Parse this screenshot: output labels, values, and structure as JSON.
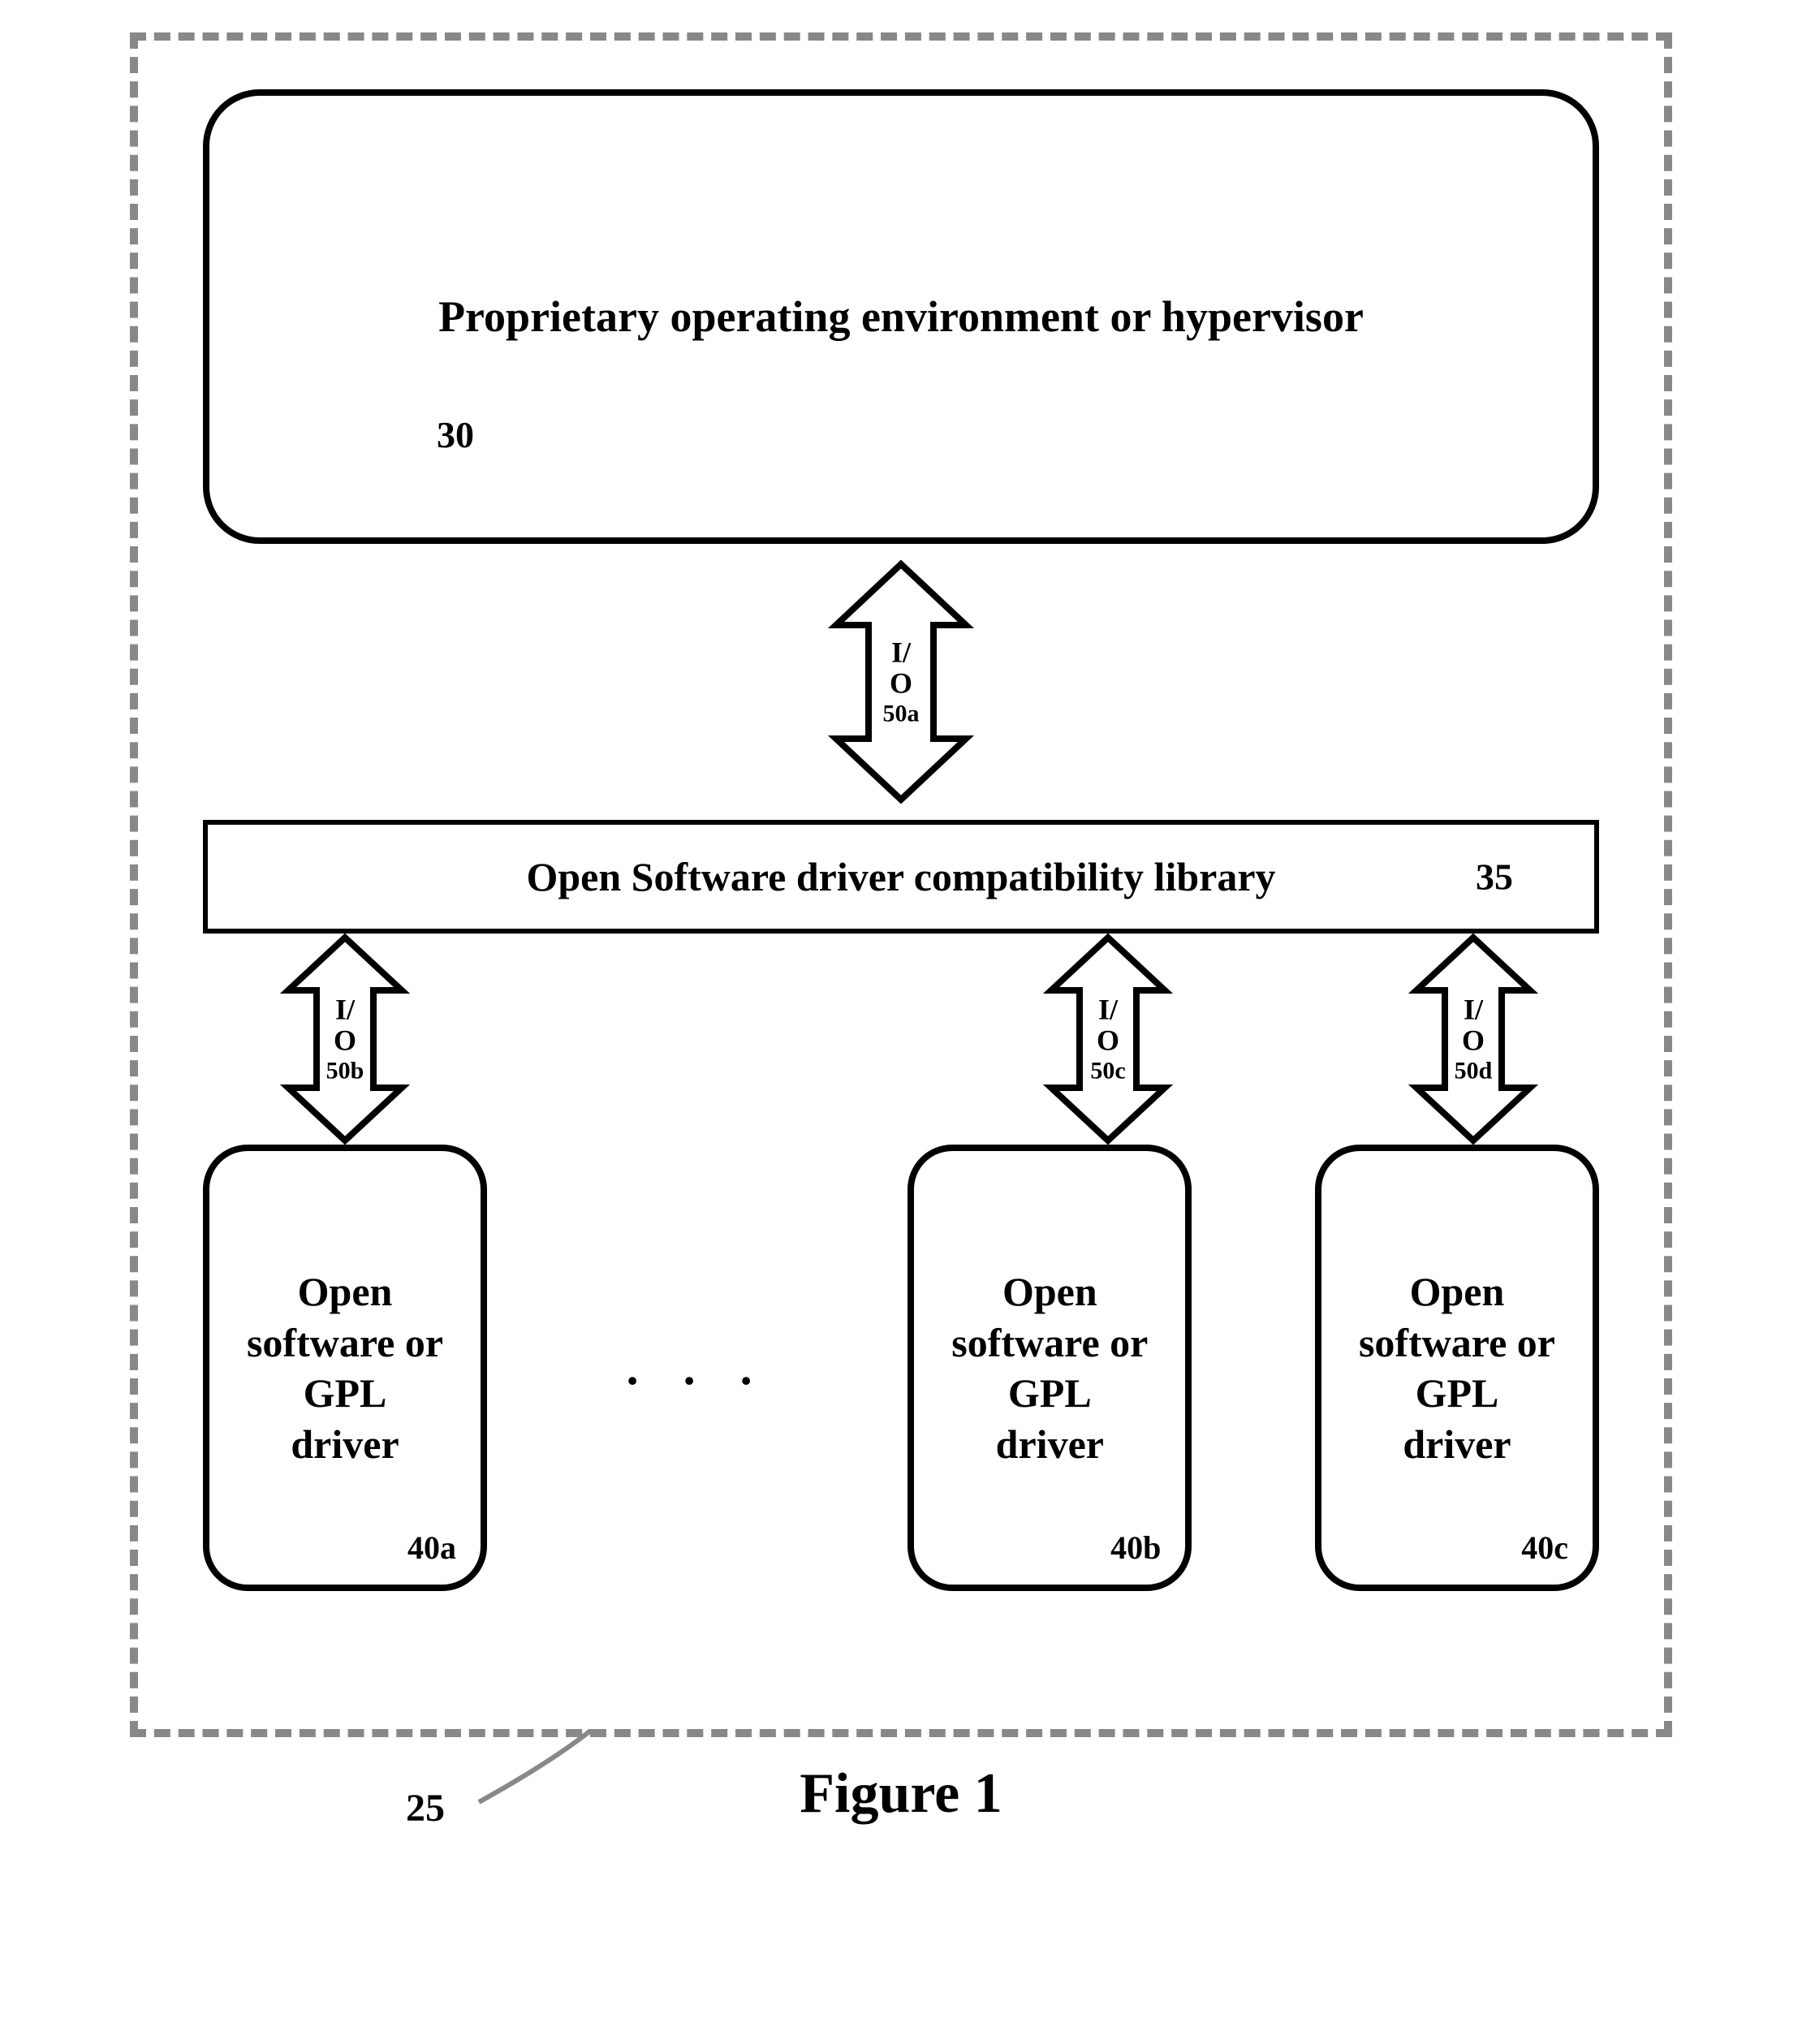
{
  "outer_ref": "25",
  "hypervisor": {
    "title": "Proprietary operating environment or hypervisor",
    "ref": "30"
  },
  "io": {
    "a": {
      "label_l1": "I/",
      "label_l2": "O",
      "ref": "50a"
    },
    "b": {
      "label_l1": "I/",
      "label_l2": "O",
      "ref": "50b"
    },
    "c": {
      "label_l1": "I/",
      "label_l2": "O",
      "ref": "50c"
    },
    "d": {
      "label_l1": "I/",
      "label_l2": "O",
      "ref": "50d"
    }
  },
  "library": {
    "title": "Open Software driver compatibility library",
    "ref": "35"
  },
  "drivers": {
    "a": {
      "l1": "Open",
      "l2": "software or",
      "l3": "GPL",
      "l4": "driver",
      "ref": "40a"
    },
    "b": {
      "l1": "Open",
      "l2": "software or",
      "l3": "GPL",
      "l4": "driver",
      "ref": "40b"
    },
    "c": {
      "l1": "Open",
      "l2": "software or",
      "l3": "GPL",
      "l4": "driver",
      "ref": "40c"
    }
  },
  "ellipsis": ". . .",
  "caption": "Figure 1"
}
